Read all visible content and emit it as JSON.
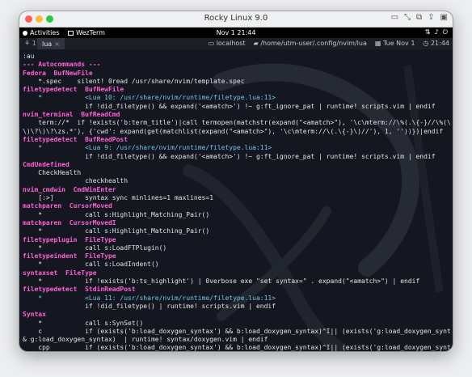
{
  "window": {
    "title": "Rocky Linux 9.0"
  },
  "gnome": {
    "activities": "Activities",
    "app": "WezTerm",
    "clock": "Nov 1  21:44"
  },
  "tabbar": {
    "lead": "⚘ 1",
    "tab_label": "lua",
    "tab_close": "×",
    "host": "localhost",
    "path": "/home/utm-user/.config/nvim/lua",
    "date": "Tue Nov 1",
    "time": "21:44"
  },
  "icons": {
    "window_toolbar": [
      "display-icon",
      "arrows-icon",
      "copy-icon",
      "share-icon",
      "window-icon"
    ],
    "system_tray": [
      "network-icon",
      "volume-icon",
      "power-icon"
    ]
  },
  "colors": {
    "highlight": "#ff5fd7",
    "comment": "#6ec7e8",
    "prompt": "#49c46b",
    "text": "#dfe3ea",
    "background": "#14171f"
  },
  "terminal": {
    "lines": [
      {
        "t": "plain",
        "text": ":au"
      },
      {
        "t": "hl",
        "text": "--- Autocommands ---"
      },
      {
        "t": "hl",
        "text": "Fedora  BufNewFile"
      },
      {
        "t": "plain",
        "text": "    *.spec    silent! 0read /usr/share/nvim/template.spec"
      },
      {
        "t": "hl",
        "text": "filetypedetect  BufNewFile"
      },
      {
        "t": "cm",
        "text": "    *           <Lua 10: /usr/share/nvim/runtime/filetype.lua:11>"
      },
      {
        "t": "plain",
        "text": "                if !did_filetype() && expand('<amatch>') !~ g:ft_ignore_pat | runtime! scripts.vim | endif"
      },
      {
        "t": "hl",
        "text": "nvim_terminal  BufReadCmd"
      },
      {
        "t": "plain",
        "text": "    term://*  if !exists('b:term_title')|call termopen(matchstr(expand(\"<amatch>\"), '\\c\\mterm://\\%(.\\{-}//\\%(\\d\\+:"
      },
      {
        "t": "plain",
        "text": "\\)\\?\\)\\?\\zs.*'), {'cwd': expand(get(matchlist(expand(\"<amatch>\"), '\\c\\mterm://\\(.\\{-}\\)//'), 1, ''))})|endif"
      },
      {
        "t": "hl",
        "text": "filetypedetect  BufReadPost"
      },
      {
        "t": "cm",
        "text": "    *           <Lua 9: /usr/share/nvim/runtime/filetype.lua:11>"
      },
      {
        "t": "plain",
        "text": "                if !did_filetype() && expand('<amatch>') !~ g:ft_ignore_pat | runtime! scripts.vim | endif"
      },
      {
        "t": "hl",
        "text": "CmdUndefined"
      },
      {
        "t": "plain",
        "text": "    CheckHealth"
      },
      {
        "t": "plain",
        "text": "                checkhealth"
      },
      {
        "t": "hl",
        "text": "nvim_cmdwin  CmdWinEnter"
      },
      {
        "t": "plain",
        "text": "    [:>]        syntax sync minlines=1 maxlines=1"
      },
      {
        "t": "hl",
        "text": "matchparen  CursorMoved"
      },
      {
        "t": "plain",
        "text": "    *           call s:Highlight_Matching_Pair()"
      },
      {
        "t": "hl",
        "text": "matchparen  CursorMovedI"
      },
      {
        "t": "plain",
        "text": "    *           call s:Highlight_Matching_Pair()"
      },
      {
        "t": "hl",
        "text": "filetypeplugin  FileType"
      },
      {
        "t": "plain",
        "text": "    *           call s:LoadFTPlugin()"
      },
      {
        "t": "hl",
        "text": "filetypeindent  FileType"
      },
      {
        "t": "plain",
        "text": "    *           call s:LoadIndent()"
      },
      {
        "t": "hl",
        "text": "syntaxset  FileType"
      },
      {
        "t": "plain",
        "text": "    *           if !exists('b:ts_highlight') | 0verbose exe \"set syntax=\" . expand(\"<amatch>\") | endif"
      },
      {
        "t": "hl",
        "text": "filetypedetect  StdinReadPost"
      },
      {
        "t": "cm",
        "text": "    *           <Lua 11: /usr/share/nvim/runtime/filetype.lua:11>"
      },
      {
        "t": "plain",
        "text": "                if !did_filetype() | runtime! scripts.vim | endif"
      },
      {
        "t": "hl",
        "text": "Syntax"
      },
      {
        "t": "plain",
        "text": "    *           call s:SynSet()"
      },
      {
        "t": "plain",
        "text": "    c           if (exists('b:load_doxygen_syntax') && b:load_doxygen_syntax)^I|| (exists('g:load_doxygen_syntax') &"
      },
      {
        "t": "plain",
        "text": "& g:load_doxygen_syntax)  | runtime! syntax/doxygen.vim | endif"
      },
      {
        "t": "plain",
        "text": "    cpp         if (exists('b:load_doxygen_syntax') && b:load_doxygen_syntax)^I|| (exists('g:load_doxygen_syntax') &"
      },
      {
        "t": "plain",
        "text": "& g:load_doxygen_syntax)  | runtime! syntax/doxygen.vim | endif"
      },
      {
        "t": "plain",
        "text": "    cs          if (exists('b:load_doxygen_syntax') && b:load_doxygen_syntax)^I|| (exists('g:load_doxygen_syntax') &"
      }
    ],
    "more_prompt": "-- More --"
  }
}
